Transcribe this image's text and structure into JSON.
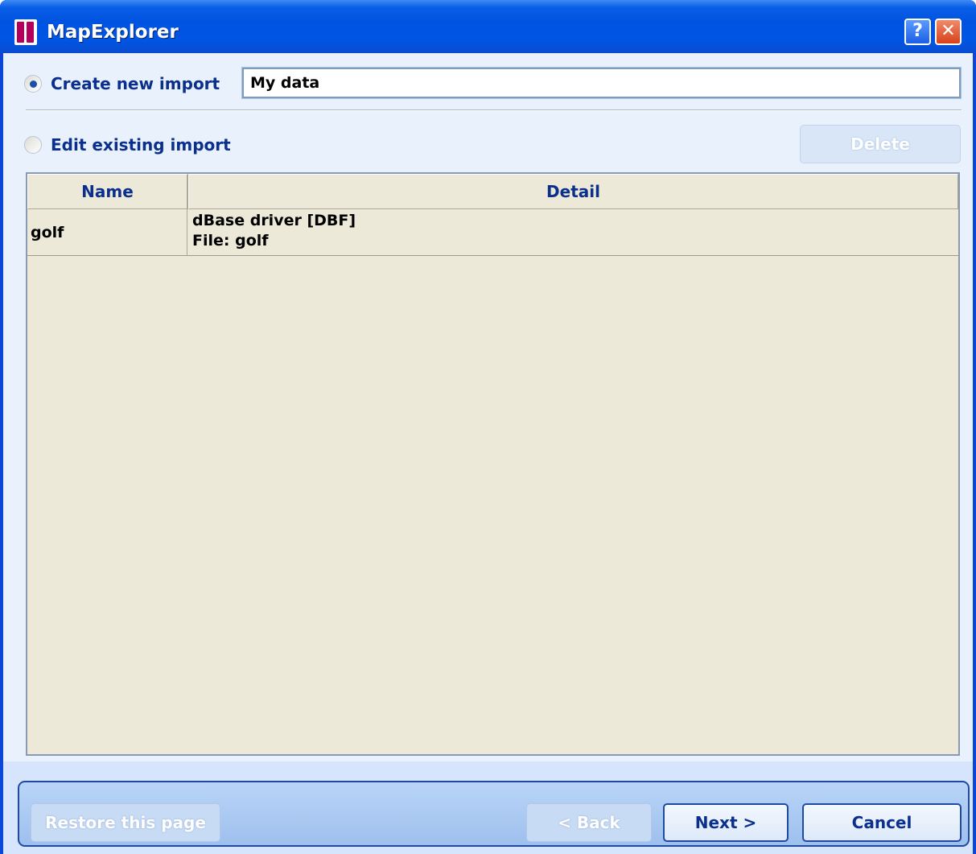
{
  "window": {
    "title": "MapExplorer",
    "help_symbol": "?",
    "close_symbol": "✕"
  },
  "create": {
    "label": "Create new import",
    "selected": true,
    "name_value": "My data"
  },
  "edit": {
    "label": "Edit existing import",
    "selected": false
  },
  "delete_label": "Delete",
  "imports": {
    "columns": [
      "Name",
      "Detail"
    ],
    "rows": [
      {
        "name": "golf",
        "detail_line1": "dBase driver [DBF]",
        "detail_line2": "File: golf"
      }
    ]
  },
  "footer": {
    "restore_label": "Restore this page",
    "back_label": "< Back",
    "next_label": "Next >",
    "cancel_label": "Cancel"
  },
  "colors": {
    "title_bar": "#0055e5",
    "panel": "#e9f1fd",
    "list_bg": "#ece9d8",
    "header_text": "#0a2f8c"
  }
}
